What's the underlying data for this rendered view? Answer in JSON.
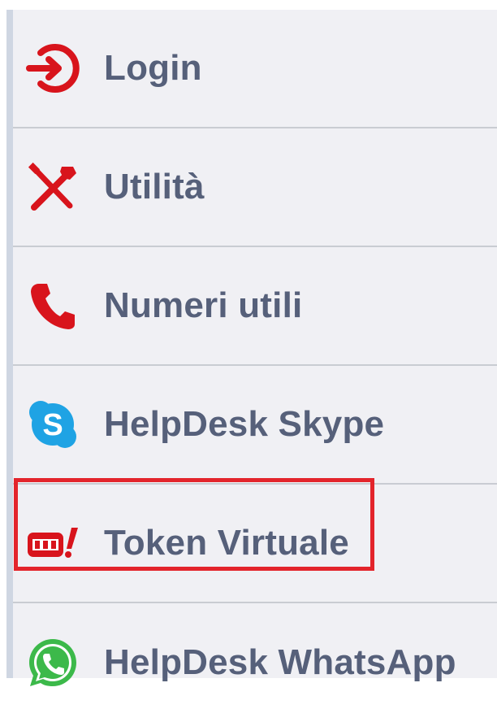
{
  "menu": {
    "items": [
      {
        "label": "Login",
        "icon": "login-icon"
      },
      {
        "label": "Utilità",
        "icon": "tools-icon"
      },
      {
        "label": "Numeri utili",
        "icon": "phone-icon"
      },
      {
        "label": "HelpDesk Skype",
        "icon": "skype-icon"
      },
      {
        "label": "Token Virtuale",
        "icon": "token-icon"
      },
      {
        "label": "HelpDesk WhatsApp",
        "icon": "whatsapp-icon"
      }
    ]
  },
  "colors": {
    "icon_red": "#d8141c",
    "label": "#56607a",
    "skype_blue": "#1fa3e4",
    "whatsapp_green": "#3cb94a",
    "highlight": "#e3242b"
  }
}
